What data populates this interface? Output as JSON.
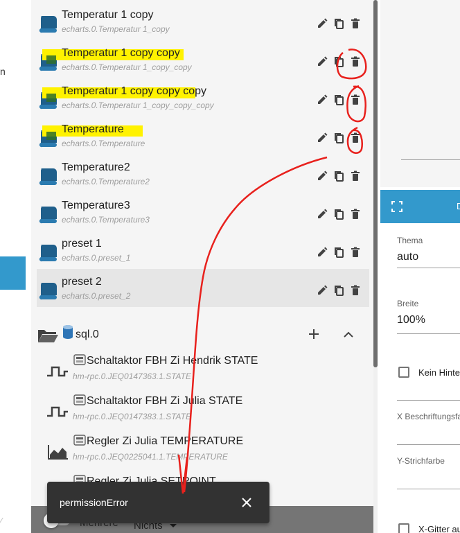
{
  "left_panel": {
    "fragment": "n",
    "corner": "⁄"
  },
  "charts": [
    {
      "title": "Temperatur 1 copy",
      "id": "echarts.0.Temperatur 1_copy"
    },
    {
      "title": "Temperatur 1 copy copy",
      "id": "echarts.0.Temperatur 1_copy_copy"
    },
    {
      "title": "Temperatur 1 copy copy copy",
      "id": "echarts.0.Temperatur 1_copy_copy_copy"
    },
    {
      "title": "Temperature",
      "id": "echarts.0.Temperature"
    },
    {
      "title": "Temperature2",
      "id": "echarts.0.Temperature2"
    },
    {
      "title": "Temperature3",
      "id": "echarts.0.Temperature3"
    },
    {
      "title": "preset 1",
      "id": "echarts.0.preset_1"
    },
    {
      "title": "preset 2",
      "id": "echarts.0.preset_2"
    }
  ],
  "folder": {
    "title": "sql.0"
  },
  "objects": [
    {
      "title": "Schaltaktor FBH Zi Hendrik STATE",
      "id": "hm-rpc.0.JEQ0147363.1.STATE"
    },
    {
      "title": "Schaltaktor FBH Zi Julia STATE",
      "id": "hm-rpc.0.JEQ0147383.1.STATE"
    },
    {
      "title": "Regler Zi Julia TEMPERATURE",
      "id": "hm-rpc.0.JEQ0225041.1.TEMPERATURE"
    },
    {
      "title": "Regler Zi Julia SETPOINT",
      "id": ""
    }
  ],
  "bottom": {
    "multi_label": "Mehrere",
    "select_value": "Nichts"
  },
  "snackbar": {
    "message": "permissionError"
  },
  "right_panel": {
    "header_letter": "D",
    "fields": [
      {
        "label": "Thema",
        "value": "auto"
      },
      {
        "label": "Breite",
        "value": "100%"
      }
    ],
    "checkbox_no_bg": "Kein Hinte",
    "x_label_color": "X Beschriftungsfa",
    "y_line_color": "Y-Strichfarbe",
    "checkbox_x_grid": "X-Gitter au"
  },
  "colors": {
    "accent": "#3399cc",
    "icon": "#1f5f8b",
    "highlight": "#fff200",
    "annotation": "#e8211d"
  }
}
